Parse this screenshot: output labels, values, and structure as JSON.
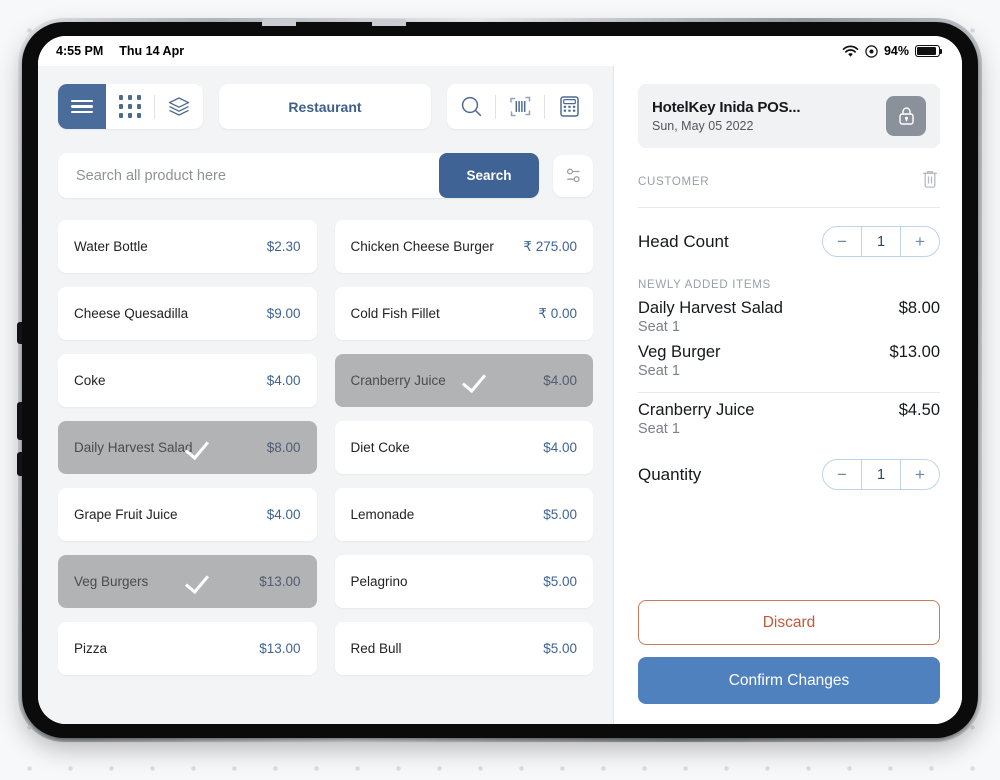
{
  "status_bar": {
    "time": "4:55 PM",
    "date": "Thu 14 Apr",
    "battery_percent": "94%",
    "wifi_icon": "wifi-icon",
    "location_icon": "location-icon",
    "battery_icon": "battery-icon"
  },
  "toolbar": {
    "menu_icon": "hamburger-menu-icon",
    "grid_icon": "grid-apps-icon",
    "layers_icon": "layers-icon",
    "outlet_label": "Restaurant",
    "search_icon": "search-icon",
    "barcode_icon": "barcode-scan-icon",
    "calculator_icon": "calculator-icon"
  },
  "search": {
    "placeholder": "Search all product here",
    "value": "",
    "button_label": "Search",
    "filter_icon": "filter-sliders-icon"
  },
  "products": [
    {
      "name": "Water Bottle",
      "price": "$2.30",
      "selected": false
    },
    {
      "name": "Chicken Cheese Burger",
      "price": "₹ 275.00",
      "selected": false
    },
    {
      "name": "Cheese Quesadilla",
      "price": "$9.00",
      "selected": false
    },
    {
      "name": "Cold Fish Fillet",
      "price": "₹ 0.00",
      "selected": false
    },
    {
      "name": "Coke",
      "price": "$4.00",
      "selected": false
    },
    {
      "name": "Cranberry Juice",
      "price": "$4.00",
      "selected": true
    },
    {
      "name": "Daily Harvest Salad",
      "price": "$8.00",
      "selected": true
    },
    {
      "name": "Diet Coke",
      "price": "$4.00",
      "selected": false
    },
    {
      "name": "Grape Fruit Juice",
      "price": "$4.00",
      "selected": false
    },
    {
      "name": "Lemonade",
      "price": "$5.00",
      "selected": false
    },
    {
      "name": "Veg Burgers",
      "price": "$13.00",
      "selected": true
    },
    {
      "name": "Pelagrino",
      "price": "$5.00",
      "selected": false
    },
    {
      "name": "Pizza",
      "price": "$13.00",
      "selected": false
    },
    {
      "name": "Red Bull",
      "price": "$5.00",
      "selected": false
    }
  ],
  "order": {
    "title": "HotelKey Inida POS...",
    "date": "Sun, May 05 2022",
    "lock_icon": "lock-icon",
    "customer_label": "CUSTOMER",
    "delete_icon": "trash-icon",
    "head_count_label": "Head Count",
    "head_count_value": "1",
    "newly_added_label": "NEWLY ADDED ITEMS",
    "items": [
      {
        "name": "Daily Harvest Salad",
        "seat": "Seat 1",
        "price": "$8.00"
      },
      {
        "name": "Veg Burger",
        "seat": "Seat 1",
        "price": "$13.00"
      },
      {
        "name": "Cranberry Juice",
        "seat": "Seat 1",
        "price": "$4.50"
      }
    ],
    "quantity_label": "Quantity",
    "quantity_value": "1",
    "discard_label": "Discard",
    "confirm_label": "Confirm Changes",
    "minus_label": "−",
    "plus_label": "+"
  },
  "colors": {
    "accent_blue": "#3f6394",
    "confirm_blue": "#5081bf",
    "discard_orange": "#c2593a",
    "selected_gray": "#b2b3b5"
  }
}
